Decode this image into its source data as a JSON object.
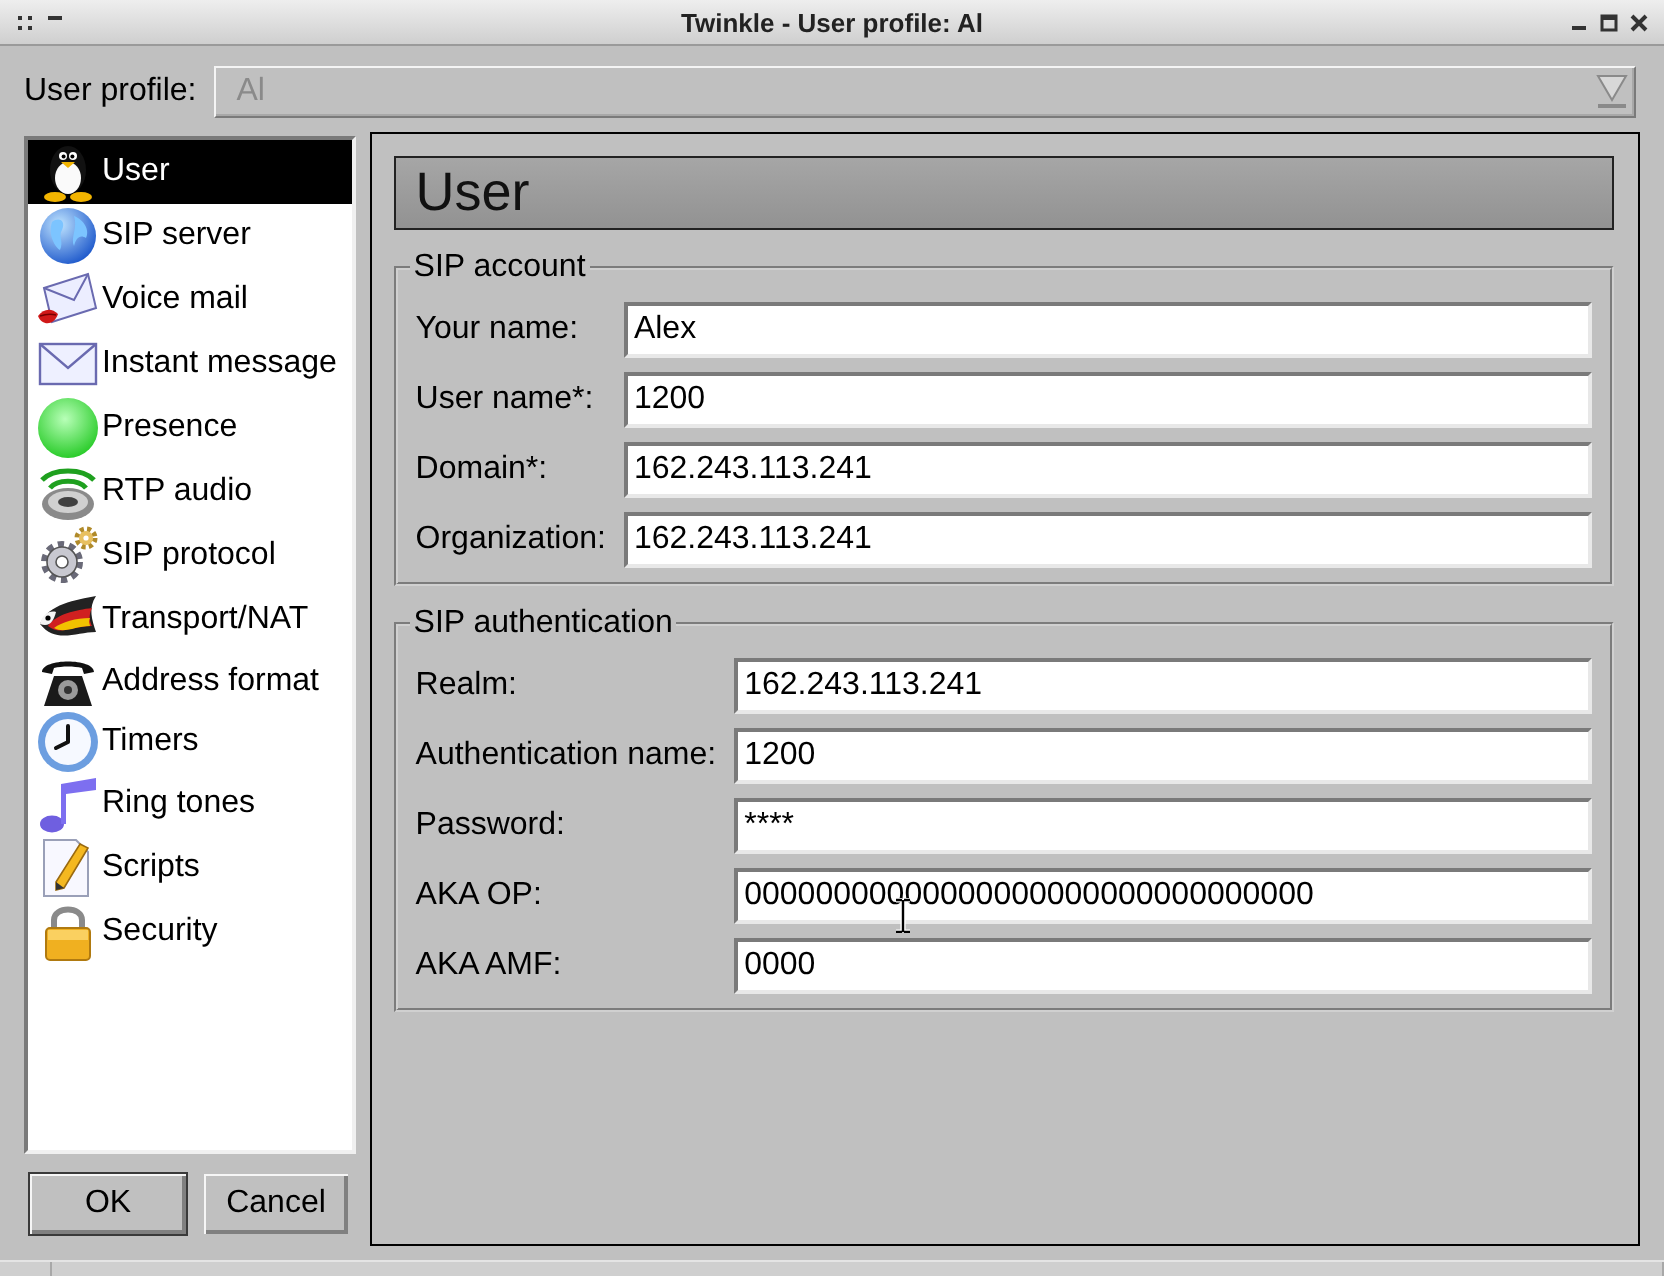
{
  "window": {
    "title": "Twinkle - User profile: Al"
  },
  "profile": {
    "label": "User profile:",
    "value": "Al",
    "disabled": true
  },
  "sidebar": {
    "items": [
      {
        "label": "User",
        "selected": true
      },
      {
        "label": "SIP server",
        "selected": false
      },
      {
        "label": "Voice mail",
        "selected": false
      },
      {
        "label": "Instant message",
        "selected": false
      },
      {
        "label": "Presence",
        "selected": false
      },
      {
        "label": "RTP audio",
        "selected": false
      },
      {
        "label": "SIP protocol",
        "selected": false
      },
      {
        "label": "Transport/NAT",
        "selected": false
      },
      {
        "label": "Address format",
        "selected": false
      },
      {
        "label": "Timers",
        "selected": false
      },
      {
        "label": "Ring tones",
        "selected": false
      },
      {
        "label": "Scripts",
        "selected": false
      },
      {
        "label": "Security",
        "selected": false
      }
    ]
  },
  "buttons": [
    {
      "label": "OK",
      "default": true
    },
    {
      "label": "Cancel",
      "default": false
    }
  ],
  "page_title": "User",
  "groups": [
    {
      "title": "SIP account",
      "fields": [
        {
          "label": "Your name:",
          "value": "Alex"
        },
        {
          "label": "User name*:",
          "value": "1200"
        },
        {
          "label": "Domain*:",
          "value": "162.243.113.241"
        },
        {
          "label": "Organization:",
          "value": "162.243.113.241"
        }
      ]
    },
    {
      "title": "SIP authentication",
      "fields": [
        {
          "label": "Realm:",
          "value": "162.243.113.241"
        },
        {
          "label": "Authentication name:",
          "value": "1200"
        },
        {
          "label": "Password:",
          "value": "****"
        },
        {
          "label": "AKA OP:",
          "value": "00000000000000000000000000000000"
        },
        {
          "label": "AKA AMF:",
          "value": "0000"
        }
      ]
    }
  ]
}
